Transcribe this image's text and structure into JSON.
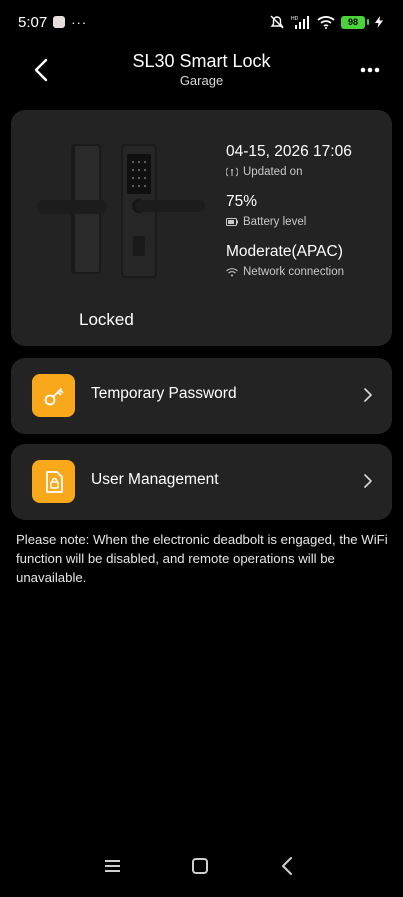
{
  "status_bar": {
    "time": "5:07",
    "more": "···",
    "battery": "98"
  },
  "header": {
    "title": "SL30 Smart Lock",
    "subtitle": "Garage"
  },
  "device": {
    "state": "Locked",
    "updated_value": "04-15, 2026 17:06",
    "updated_label": "Updated on",
    "battery_value": "75%",
    "battery_label": "Battery level",
    "network_value": "Moderate(APAC)",
    "network_label": "Network connection"
  },
  "menu": [
    {
      "label": "Temporary Password",
      "icon": "key-icon"
    },
    {
      "label": "User Management",
      "icon": "user-doc-lock-icon"
    }
  ],
  "note": "Please note: When the electronic deadbolt is engaged, the WiFi function will be disabled, and remote operations will be unavailable.",
  "colors": {
    "background": "#000000",
    "card": "#232323",
    "accent": "#f9a81b",
    "battery": "#4ad33b"
  }
}
